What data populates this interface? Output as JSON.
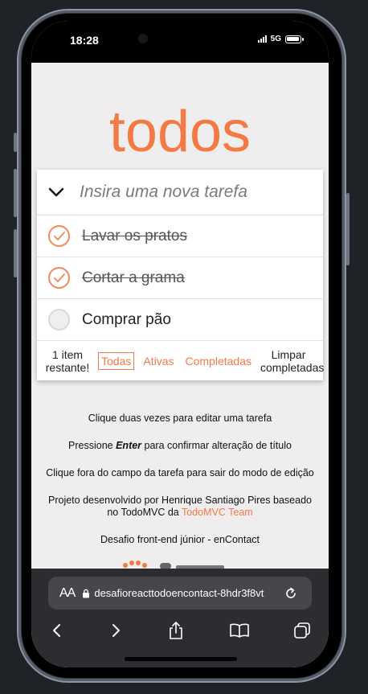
{
  "status_bar": {
    "time": "18:28",
    "network": "5G"
  },
  "app": {
    "title": "todos",
    "new_todo_placeholder": "Insira uma nova tarefa",
    "todos": [
      {
        "label": "Lavar os pratos",
        "completed": true
      },
      {
        "label": "Cortar a grama",
        "completed": true
      },
      {
        "label": "Comprar pão",
        "completed": false
      }
    ],
    "footer": {
      "count_line1": "1 item",
      "count_line2": "restante!",
      "filters": [
        {
          "label": "Todas",
          "selected": true
        },
        {
          "label": "Ativas",
          "selected": false
        },
        {
          "label": "Completadas",
          "selected": false
        }
      ],
      "clear_line1": "Limpar",
      "clear_line2": "completadas"
    },
    "info": {
      "line1": "Clique duas vezes para editar uma tarefa",
      "line2_before": "Pressione ",
      "line2_key": "Enter",
      "line2_after": " para confirmar alteração de título",
      "line3": "Clique fora do campo da tarefa para sair do modo de edição",
      "line4_part1": "Projeto desenvolvido por Henrique Santiago Pires baseado",
      "line4_part2": "no TodoMVC da ",
      "line4_link": "TodoMVC Team",
      "line5": "Desafio front-end júnior - enContact"
    },
    "accent_color": "#f47a45"
  },
  "browser": {
    "aa_label": "AA",
    "url": "desafioreacttodoencontact-8hdr3f8vt",
    "icons": [
      "back-icon",
      "forward-icon",
      "share-icon",
      "bookmarks-icon",
      "tabs-icon"
    ]
  }
}
